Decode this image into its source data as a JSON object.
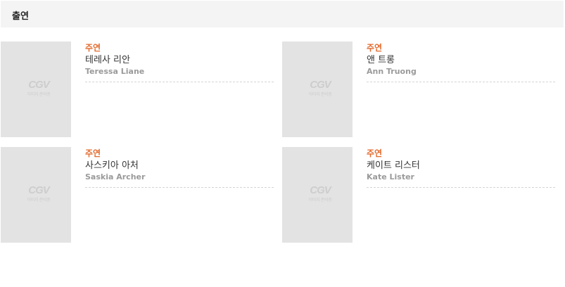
{
  "section": {
    "title": "출연"
  },
  "logo": {
    "mark": "CGV",
    "sub": "이미지 준비중"
  },
  "cast": [
    {
      "role": "주연",
      "name_ko": "테레사 리안",
      "name_en": "Teressa Liane"
    },
    {
      "role": "주연",
      "name_ko": "앤 트롱",
      "name_en": "Ann Truong"
    },
    {
      "role": "주연",
      "name_ko": "사스키아 아처",
      "name_en": "Saskia Archer"
    },
    {
      "role": "주연",
      "name_ko": "케이트 리스터",
      "name_en": "Kate Lister"
    }
  ],
  "colors": {
    "role": "#e36a2c",
    "photo_bg": "#e3e3e3",
    "header_bg": "#f4f4f4"
  }
}
